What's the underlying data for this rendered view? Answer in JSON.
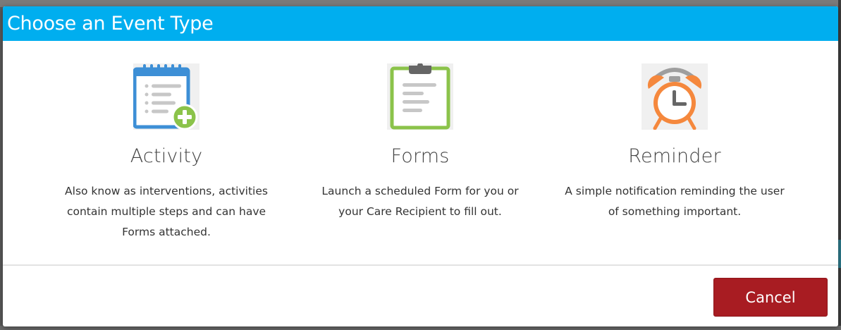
{
  "modal": {
    "title": "Choose an Event Type",
    "header_color": "#00aeef"
  },
  "options": [
    {
      "title": "Activity",
      "description": "Also know as interventions, activities contain multiple steps and can have Forms attached.",
      "icon": "notebook-add-icon"
    },
    {
      "title": "Forms",
      "description": "Launch a scheduled Form for you or your Care Recipient to fill out.",
      "icon": "clipboard-icon"
    },
    {
      "title": "Reminder",
      "description": "A simple notification reminding the user of something important.",
      "icon": "alarm-clock-icon"
    }
  ],
  "footer": {
    "cancel_label": "Cancel",
    "cancel_color": "#a81c22"
  }
}
